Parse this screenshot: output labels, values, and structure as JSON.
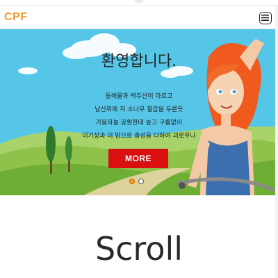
{
  "header": {
    "logo": "CPF",
    "menu_icon": "hamburger-icon"
  },
  "hero": {
    "title": "환영합니다.",
    "lines": [
      "동해물과 백두산이 마르고",
      "남산위에 저 소나무 철갑을 두른듯",
      "가을하늘 공활한데 높고 구름없이",
      "이기상과 이 맘으로 충성을 다하여 괴로우나"
    ],
    "more_label": "MORE",
    "slides": 2,
    "active_slide": 1
  },
  "section": {
    "heading": "Scroll"
  },
  "colors": {
    "logo": "#f39a1f",
    "button": "#d90f10",
    "sky": "#4fc3e6",
    "grass": "#8bc34a"
  }
}
